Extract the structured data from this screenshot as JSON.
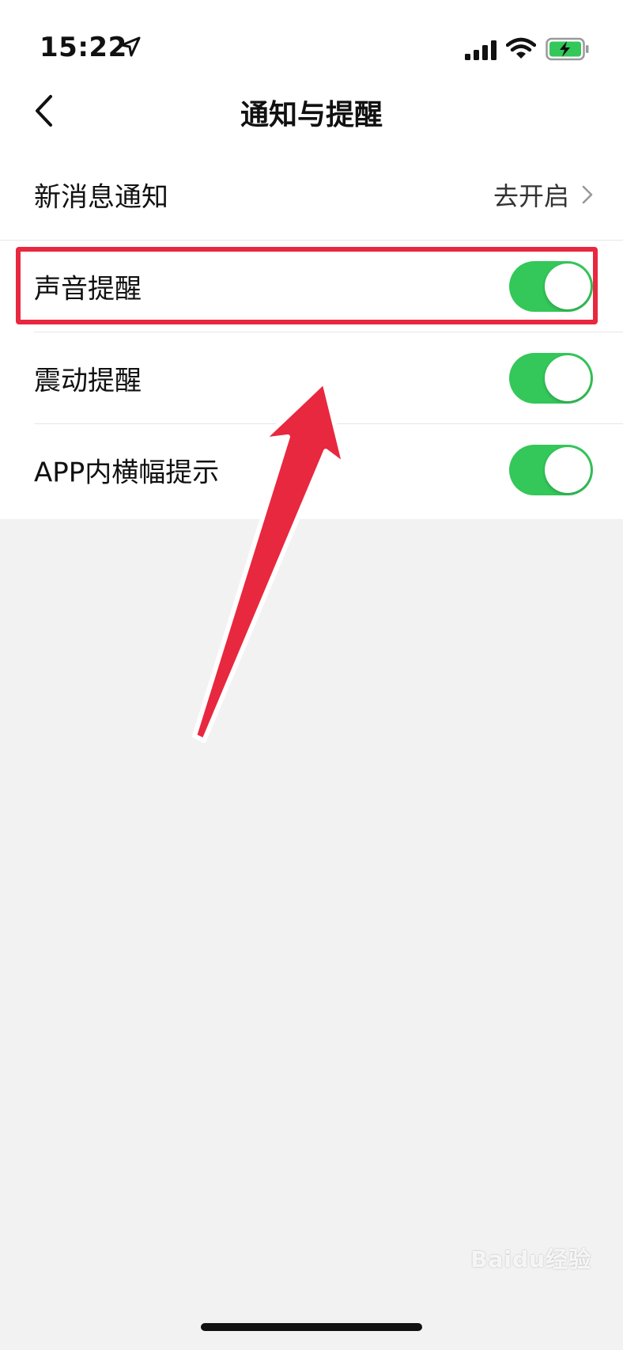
{
  "status_bar": {
    "time": "15:22",
    "icons": [
      "location-arrow-icon",
      "signal-icon",
      "wifi-icon",
      "battery-charging-icon"
    ]
  },
  "nav": {
    "title": "通知与提醒",
    "back_icon": "chevron-left-icon"
  },
  "settings": {
    "new_message": {
      "label": "新消息通知",
      "value": "去开启"
    },
    "sound": {
      "label": "声音提醒",
      "enabled": true
    },
    "vibration": {
      "label": "震动提醒",
      "enabled": true
    },
    "banner": {
      "label": "APP内横幅提示",
      "enabled": true
    }
  },
  "colors": {
    "toggle_on": "#34c759",
    "annotation_red": "#e8283f",
    "battery_green": "#34c759"
  },
  "watermark": {
    "text": "Baidu经验"
  }
}
